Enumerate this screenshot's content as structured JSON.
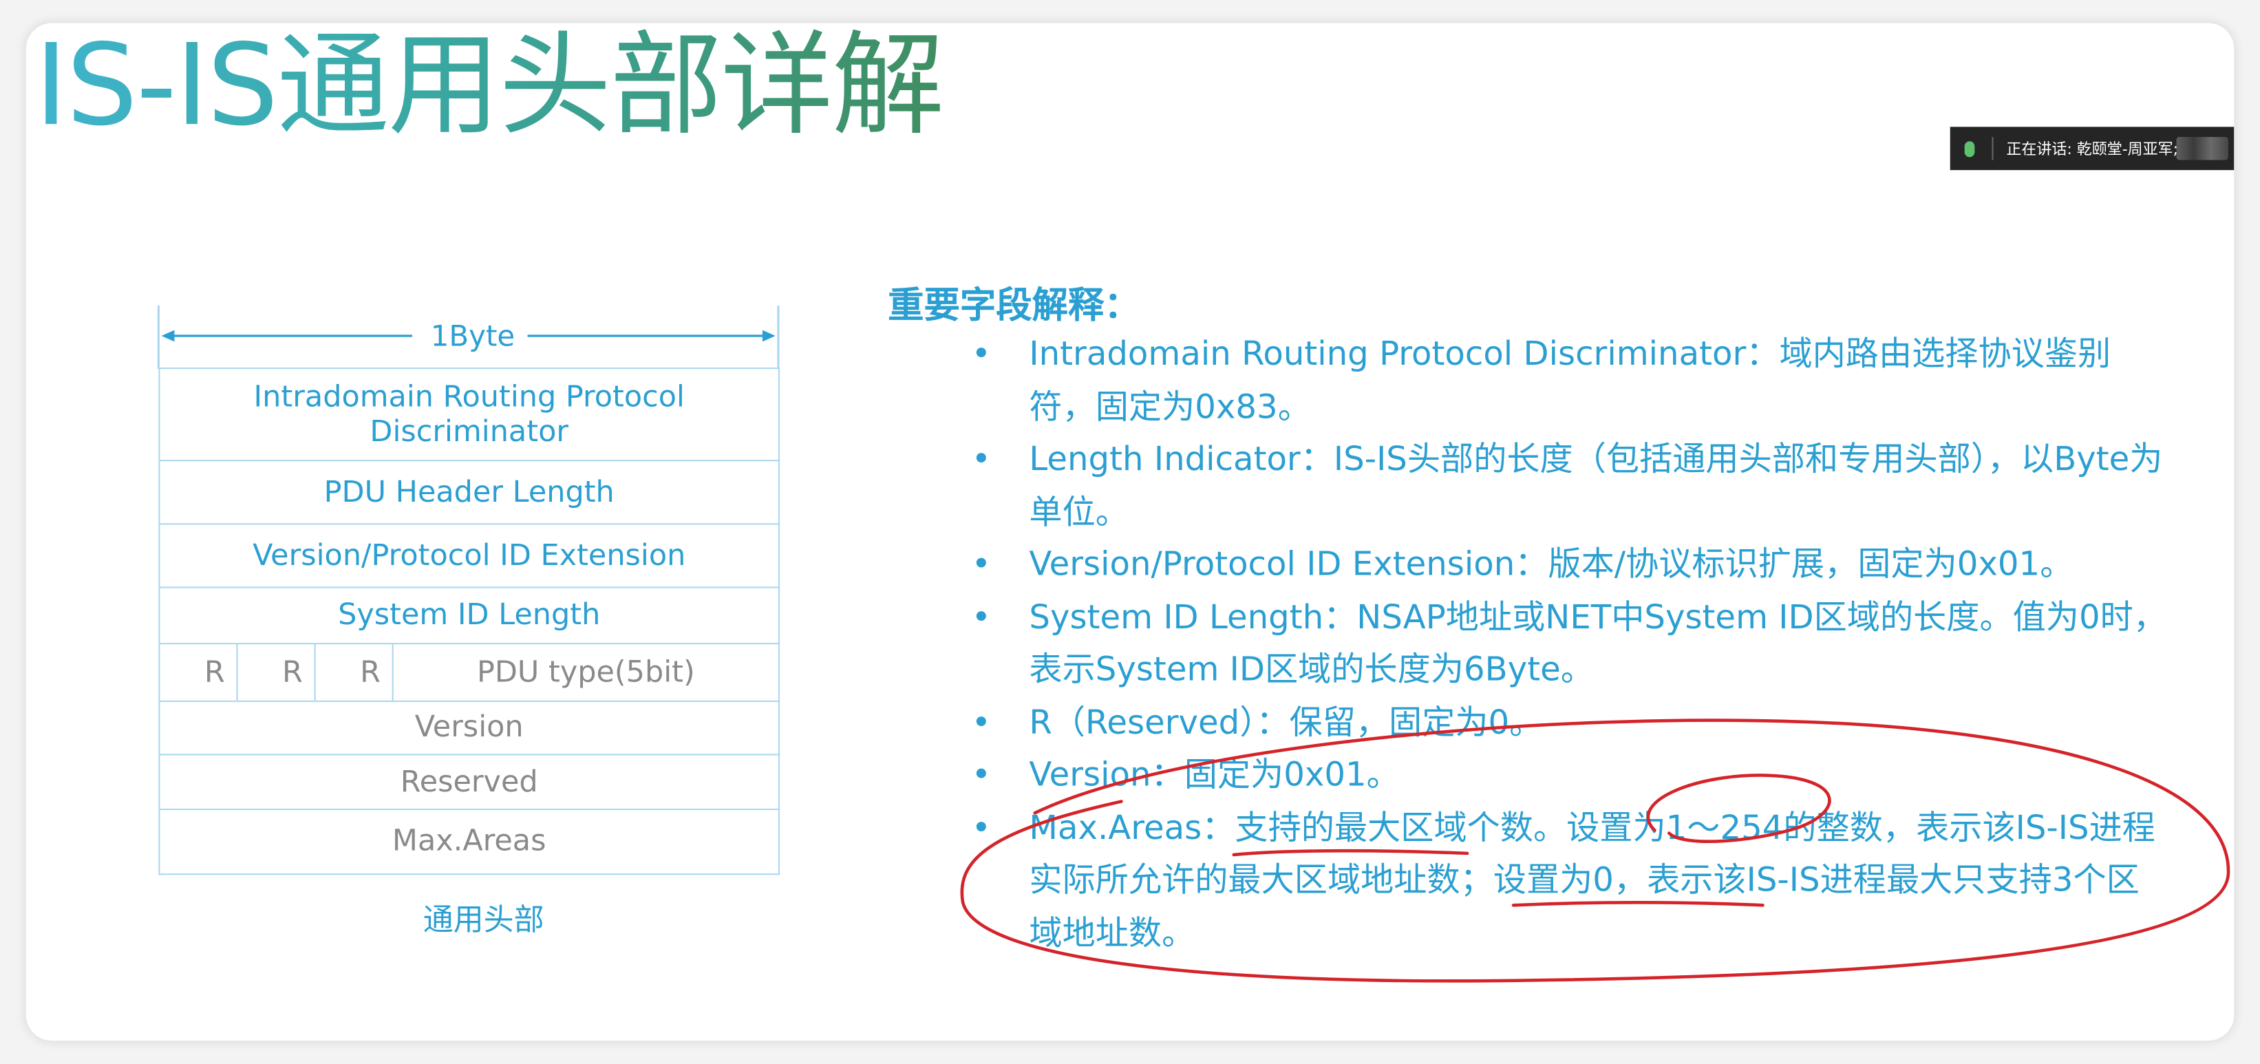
{
  "slide": {
    "title": "IS-IS通用头部详解"
  },
  "speaking_indicator": {
    "text": "正在讲话: 乾颐堂-周亚军;"
  },
  "header_diagram": {
    "width_label": "1Byte",
    "rows": [
      "Intradomain Routing Protocol Discriminator",
      "PDU Header Length",
      "Version/Protocol ID Extension",
      "System ID Length"
    ],
    "pdu_row": {
      "r1": "R",
      "r2": "R",
      "r3": "R",
      "pdu_type": "PDU type(5bit)"
    },
    "rows_after": [
      "Version",
      "Reserved",
      "Max.Areas"
    ],
    "caption": "通用头部"
  },
  "explanations": {
    "heading": "重要字段解释：",
    "bullet_char": "•",
    "items": [
      "Intradomain Routing Protocol Discriminator：域内路由选择协议鉴别符，固定为0x83。",
      "Length Indicator：IS-IS头部的长度（包括通用头部和专用头部），以Byte为单位。",
      "Version/Protocol ID Extension：版本/协议标识扩展，固定为0x01。",
      "System ID Length：NSAP地址或NET中System ID区域的长度。值为0时，表示System ID区域的长度为6Byte。",
      "R（Reserved）：保留，固定为0。",
      "Version：固定为0x01。",
      "Max.Areas：支持的最大区域个数。设置为1～254的整数，表示该IS-IS进程实际所允许的最大区域地址数；设置为0，表示该IS-IS进程最大只支持3个区域地址数。"
    ]
  },
  "annotation": {
    "ink_color": "#d4242a"
  }
}
